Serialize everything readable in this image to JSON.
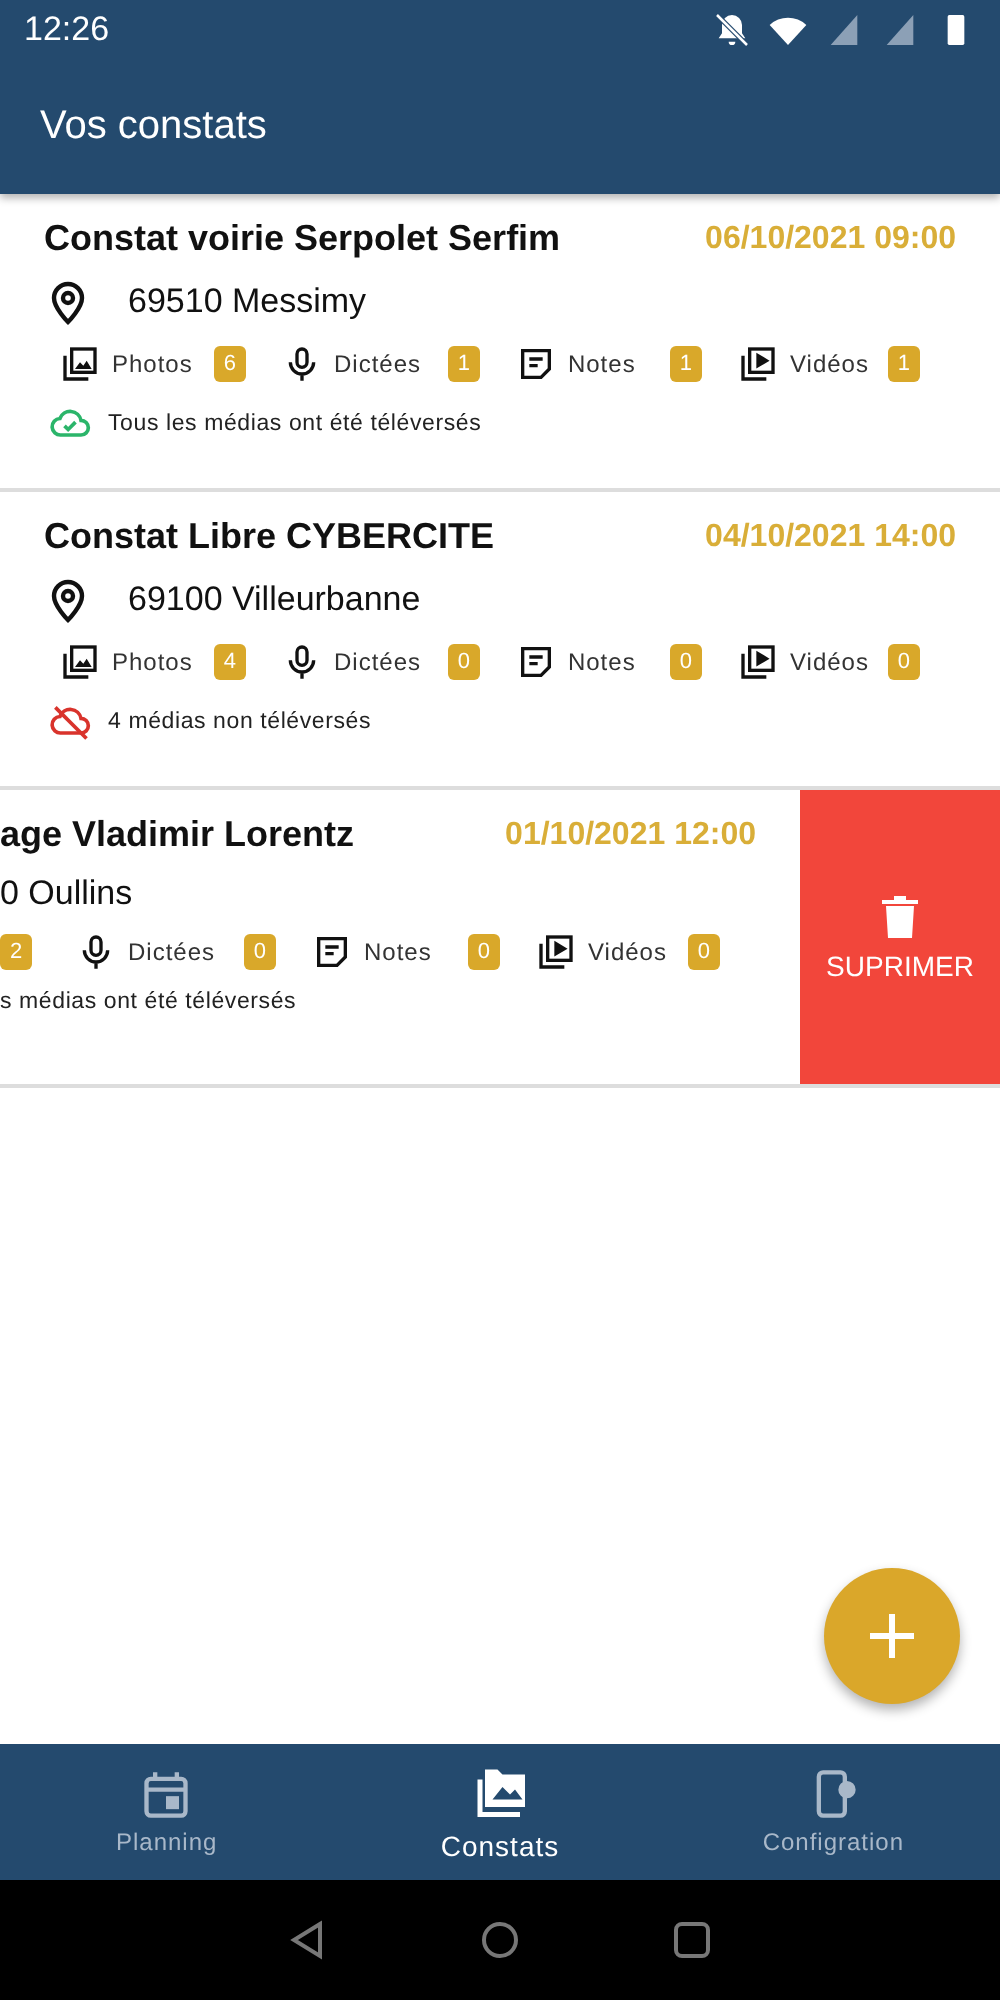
{
  "status_bar": {
    "time": "12:26"
  },
  "app_bar": {
    "title": "Vos constats"
  },
  "constats": [
    {
      "title": "Constat voirie Serpolet Serfim",
      "date": "06/10/2021 09:00",
      "address": "69510 Messimy",
      "clipped": false,
      "uploaded": true,
      "status": "Tous les médias ont été téléversés",
      "media": [
        {
          "kind": "photos",
          "label": "Photos",
          "count": "6"
        },
        {
          "kind": "dictees",
          "label": "Dictées",
          "count": "1"
        },
        {
          "kind": "notes",
          "label": "Notes",
          "count": "1"
        },
        {
          "kind": "videos",
          "label": "Vidéos",
          "count": "1"
        }
      ]
    },
    {
      "title": "Constat Libre CYBERCITE",
      "date": "04/10/2021 14:00",
      "address": "69100 Villeurbanne",
      "clipped": false,
      "uploaded": false,
      "status": "4 médias non téléversés",
      "media": [
        {
          "kind": "photos",
          "label": "Photos",
          "count": "4"
        },
        {
          "kind": "dictees",
          "label": "Dictées",
          "count": "0"
        },
        {
          "kind": "notes",
          "label": "Notes",
          "count": "0"
        },
        {
          "kind": "videos",
          "label": "Vidéos",
          "count": "0"
        }
      ]
    },
    {
      "title": "age Vladimir Lorentz",
      "date": "01/10/2021 12:00",
      "address": "0 Oullins",
      "clipped": true,
      "status": "s médias ont été téléversés",
      "delete_action": "SUPRIMER",
      "media": [
        {
          "count": "2"
        },
        {
          "kind": "dictees",
          "label": "Dictées",
          "count": "0"
        },
        {
          "kind": "notes",
          "label": "Notes",
          "count": "0"
        },
        {
          "kind": "videos",
          "label": "Vidéos",
          "count": "0"
        }
      ]
    }
  ],
  "bottom_nav": [
    {
      "kind": "planning",
      "label": "Planning",
      "selected": false
    },
    {
      "kind": "constats",
      "label": "Constats",
      "selected": true
    },
    {
      "kind": "config",
      "label": "Configration",
      "selected": false
    }
  ]
}
